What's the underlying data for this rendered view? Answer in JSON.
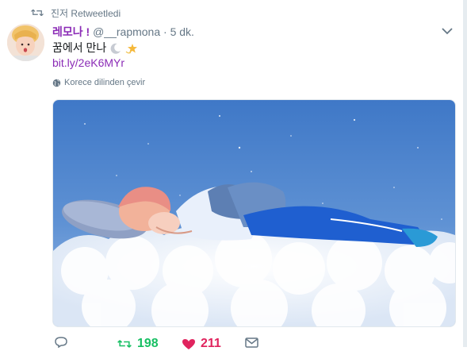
{
  "retweet": {
    "text": "진저 Retweetledi",
    "icon": "retweet-icon"
  },
  "author": {
    "name": "레모나 !",
    "handle": "@__rapmona",
    "separator": "·",
    "time": "5 dk."
  },
  "tweet": {
    "text": "꿈에서 만나",
    "emojis": [
      "crescent-moon-emoji",
      "dizzy-star-emoji"
    ],
    "link": "bit.ly/2eK6MYr",
    "translate_label": "Korece dilinden çevir"
  },
  "actions": {
    "reply": {
      "icon": "reply-icon",
      "count": ""
    },
    "retweet": {
      "icon": "retweet-icon",
      "count": "198"
    },
    "like": {
      "icon": "heart-icon",
      "count": "211"
    },
    "message": {
      "icon": "message-icon"
    }
  },
  "colors": {
    "name": "#8b2bb6",
    "link": "#8b2bb6",
    "retweet_active": "#17bf63",
    "like_active": "#e0245e",
    "muted": "#657786"
  }
}
